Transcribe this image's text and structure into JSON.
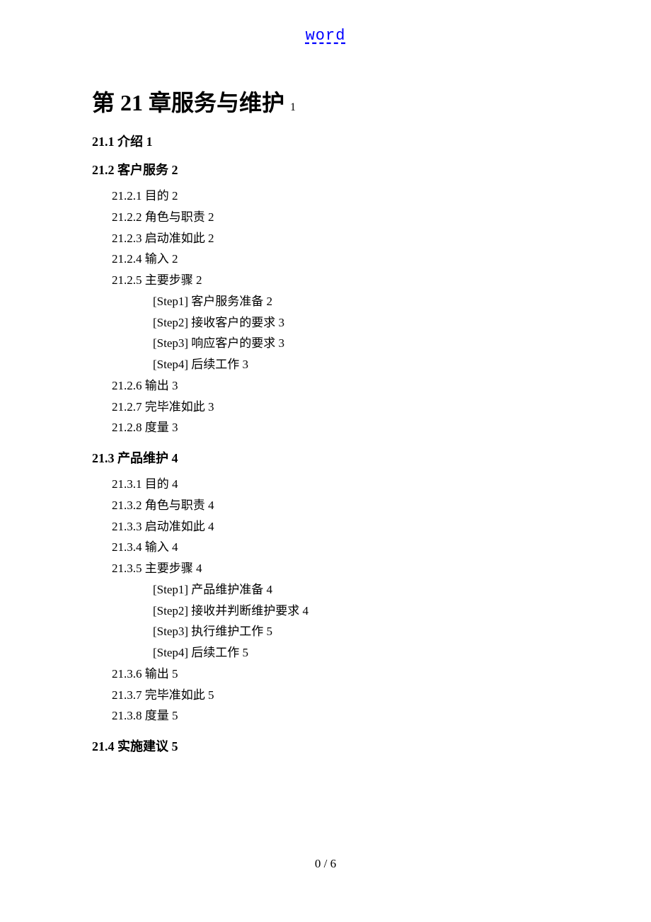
{
  "header": {
    "link_text": "word"
  },
  "chapter": {
    "title": "第 21 章服务与维护",
    "page": "1"
  },
  "sections": [
    {
      "title": "21.1 介绍 1",
      "entries": [],
      "steps": []
    },
    {
      "title": "21.2 客户服务 2",
      "entries": [
        "21.2.1 目的 2",
        "21.2.2 角色与职责 2",
        "21.2.3 启动准如此 2",
        "21.2.4 输入 2",
        "21.2.5 主要步骤 2"
      ],
      "steps": [
        "[Step1]  客户服务准备 2",
        "[Step2]  接收客户的要求 3",
        "[Step3]  响应客户的要求 3",
        "[Step4]  后续工作 3"
      ],
      "entries_after": [
        "21.2.6 输出 3",
        "21.2.7 完毕准如此 3",
        "21.2.8 度量 3"
      ]
    },
    {
      "title": "21.3 产品维护 4",
      "entries": [
        "21.3.1 目的 4",
        "21.3.2 角色与职责 4",
        "21.3.3 启动准如此 4",
        "21.3.4 输入 4",
        "21.3.5 主要步骤 4"
      ],
      "steps": [
        "[Step1]  产品维护准备 4",
        "[Step2]  接收并判断维护要求 4",
        "[Step3]  执行维护工作 5",
        "[Step4]  后续工作 5"
      ],
      "entries_after": [
        "21.3.6 输出 5",
        "21.3.7 完毕准如此 5",
        "21.3.8 度量 5"
      ]
    },
    {
      "title": "21.4 实施建议 5",
      "entries": [],
      "steps": []
    }
  ],
  "footer": {
    "page_number": "0 / 6"
  }
}
